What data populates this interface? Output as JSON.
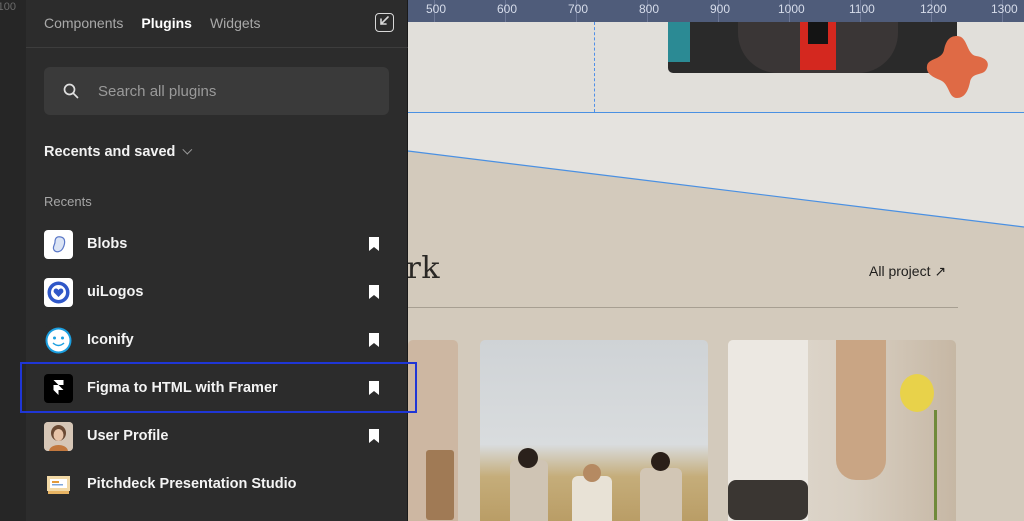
{
  "ruler": {
    "left_value": "-100",
    "labels": [
      "500",
      "600",
      "700",
      "800",
      "900",
      "1000",
      "1100",
      "1200",
      "1300"
    ]
  },
  "panel": {
    "tabs": [
      {
        "label": "Components",
        "active": false
      },
      {
        "label": "Plugins",
        "active": true
      },
      {
        "label": "Widgets",
        "active": false
      }
    ],
    "search": {
      "placeholder": "Search all plugins",
      "icon": "search-icon"
    },
    "section_title": "Recents and saved",
    "subheader": "Recents",
    "plugins": [
      {
        "name": "Blobs",
        "icon": "blobs-plugin-icon",
        "bookmarked": true
      },
      {
        "name": "uiLogos",
        "icon": "uilogos-plugin-icon",
        "bookmarked": true
      },
      {
        "name": "Iconify",
        "icon": "iconify-plugin-icon",
        "bookmarked": true
      },
      {
        "name": "Figma to HTML with Framer",
        "icon": "framer-plugin-icon",
        "bookmarked": true,
        "highlighted": true
      },
      {
        "name": "User Profile",
        "icon": "user-profile-plugin-icon",
        "bookmarked": true
      },
      {
        "name": "Pitchdeck Presentation Studio",
        "icon": "pitchdeck-plugin-icon",
        "bookmarked": false
      }
    ]
  },
  "canvas": {
    "section_title": "ork",
    "all_link": "All project ↗"
  },
  "colors": {
    "panel_bg": "#2c2c2c",
    "ruler_bg": "#4f5c7a",
    "highlight": "#1f36d6",
    "guide": "#4a90e2",
    "accent_blob": "#df6a45"
  }
}
